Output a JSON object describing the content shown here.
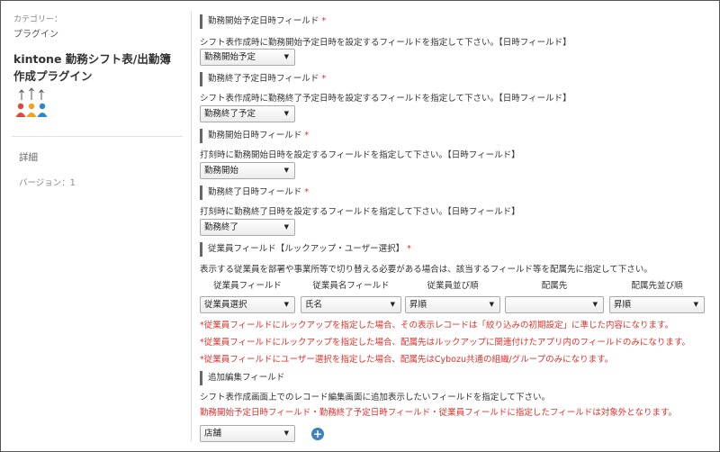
{
  "sidebar": {
    "category_label": "カテゴリー：",
    "category_value": "プラグイン",
    "plugin_title": "kintone 勤務シフト表/出勤簿作成プラグイン",
    "detail_link": "詳細",
    "version": "バージョン：1"
  },
  "sections": {
    "start_planned": {
      "title": "勤務開始予定日時フィールド",
      "required_mark": "*",
      "description": "シフト表作成時に勤務開始予定日時を設定するフィールドを指定して下さい。【日時フィールド】",
      "selected": "勤務開始予定"
    },
    "end_planned": {
      "title": "勤務終了予定日時フィールド",
      "required_mark": "*",
      "description": "シフト表作成時に勤務終了予定日時を設定するフィールドを指定して下さい。【日時フィールド】",
      "selected": "勤務終了予定"
    },
    "start_actual": {
      "title": "勤務開始日時フィールド",
      "required_mark": "*",
      "description": "打刻時に勤務開始日時を設定するフィールドを指定して下さい。【日時フィールド】",
      "selected": "勤務開始"
    },
    "end_actual": {
      "title": "勤務終了日時フィールド",
      "required_mark": "*",
      "description": "打刻時に勤務終了日時を設定するフィールドを指定して下さい。【日時フィールド】",
      "selected": "勤務終了"
    },
    "employee": {
      "title": "従業員フィールド【ルックアップ・ユーザー選択】",
      "required_mark": "*",
      "description": "表示する従業員を部署や事業所等で切り替える必要がある場合は、該当するフィールド等を配属先に指定して下さい。",
      "columns": [
        "従業員フィールド",
        "従業員名フィールド",
        "従業員並び順",
        "配属先",
        "配属先並び順"
      ],
      "values": [
        "従業員選択",
        "氏名",
        "昇順",
        "",
        "昇順"
      ],
      "notes": [
        "*従業員フィールドにルックアップを指定した場合、その表示レコードは「絞り込みの初期設定」に準じた内容になります。",
        "*従業員フィールドにルックアップを指定した場合、配属先はルックアップに関連付けたアプリ内のフィールドのみになります。",
        "*従業員フィールドにユーザー選択を指定した場合、配属先はCybozu共通の組織/グループのみになります。"
      ]
    },
    "additional": {
      "title": "追加編集フィールド",
      "description": "シフト表作成画面上でのレコード編集画面に追加表示したいフィールドを指定して下さい。",
      "warning": "勤務開始予定日時フィールド・勤務終了予定日時フィールド・従業員フィールドに指定したフィールドは対象外となります。",
      "selected": "店舗"
    }
  },
  "icons": {
    "dropdown": "dropdown-arrow-icon",
    "add": "add-circle-icon",
    "plugin": "people-upload-icon"
  },
  "colors": {
    "required": "#e0302a",
    "add_button": "#3b82c4"
  }
}
